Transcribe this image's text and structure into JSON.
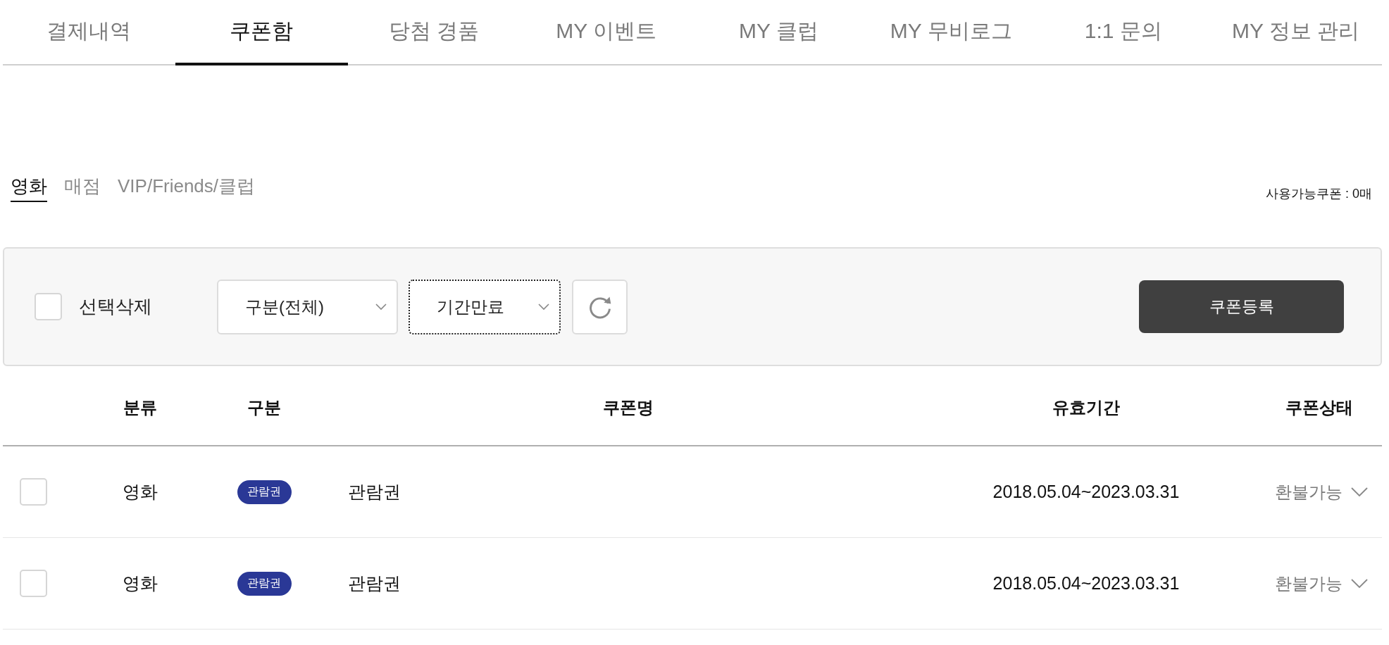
{
  "tabs": [
    {
      "label": "결제내역",
      "selected": false
    },
    {
      "label": "쿠폰함",
      "selected": true
    },
    {
      "label": "당첨 경품",
      "selected": false
    },
    {
      "label": "MY 이벤트",
      "selected": false
    },
    {
      "label": "MY 클럽",
      "selected": false
    },
    {
      "label": "MY 무비로그",
      "selected": false
    },
    {
      "label": "1:1 문의",
      "selected": false
    },
    {
      "label": "MY 정보 관리",
      "selected": false
    }
  ],
  "coupon_tabs": [
    {
      "label": "영화",
      "selected": true
    },
    {
      "label": "매점",
      "selected": false
    },
    {
      "label": "VIP/Friends/클럽",
      "selected": false
    }
  ],
  "available_coupons": "사용가능쿠폰 : 0매",
  "filter_bar": {
    "select_all": {
      "label": "선택삭제",
      "checked": false
    },
    "selects": [
      {
        "value": "구분(전체)",
        "focused": false
      },
      {
        "value": "기간만료",
        "focused": true
      }
    ],
    "register_button": "쿠폰등록"
  },
  "table": {
    "columns": [
      "분류",
      "구분",
      "쿠폰명",
      "유효기간",
      "쿠폰상태"
    ],
    "rows": [
      {
        "checked": false,
        "category": "영화",
        "type_badge": "관람권",
        "name": "관람권",
        "validity": "2018.05.04~2023.03.31",
        "status": "환불가능"
      },
      {
        "checked": false,
        "category": "영화",
        "type_badge": "관람권",
        "name": "관람권",
        "validity": "2018.05.04~2023.03.31",
        "status": "환불가능"
      }
    ]
  }
}
